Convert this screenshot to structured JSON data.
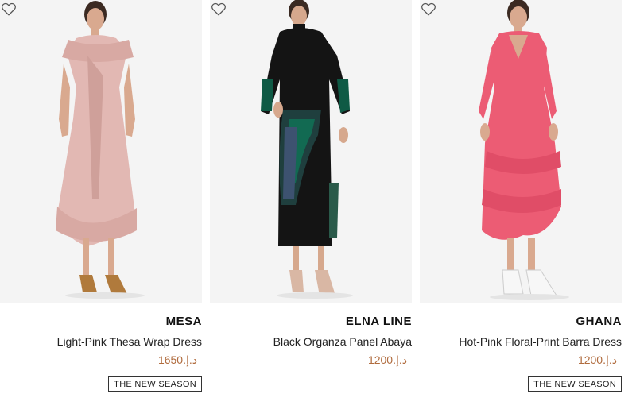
{
  "products": [
    {
      "brand": "MESA",
      "name": "Light-Pink Thesa Wrap Dress",
      "price": "1650",
      "currency": "د.إ.",
      "badge": "THE NEW SEASON",
      "image_icon": "model-in-light-pink-wrap-dress",
      "dress_color": "#e2b8b3"
    },
    {
      "brand": "ELNA LINE",
      "name": "Black Organza Panel Abaya",
      "price": "1200",
      "currency": "د.إ.",
      "image_icon": "model-in-black-abaya",
      "dress_color": "#141414"
    },
    {
      "brand": "GHANA",
      "name": "Hot-Pink Floral-Print Barra Dress",
      "price": "1200",
      "currency": "د.إ.",
      "badge": "THE NEW SEASON",
      "image_icon": "model-in-hot-pink-dress",
      "dress_color": "#ec5c74"
    }
  ],
  "colors": {
    "price": "#b06b3d",
    "image_bg": "#f4f4f4"
  }
}
